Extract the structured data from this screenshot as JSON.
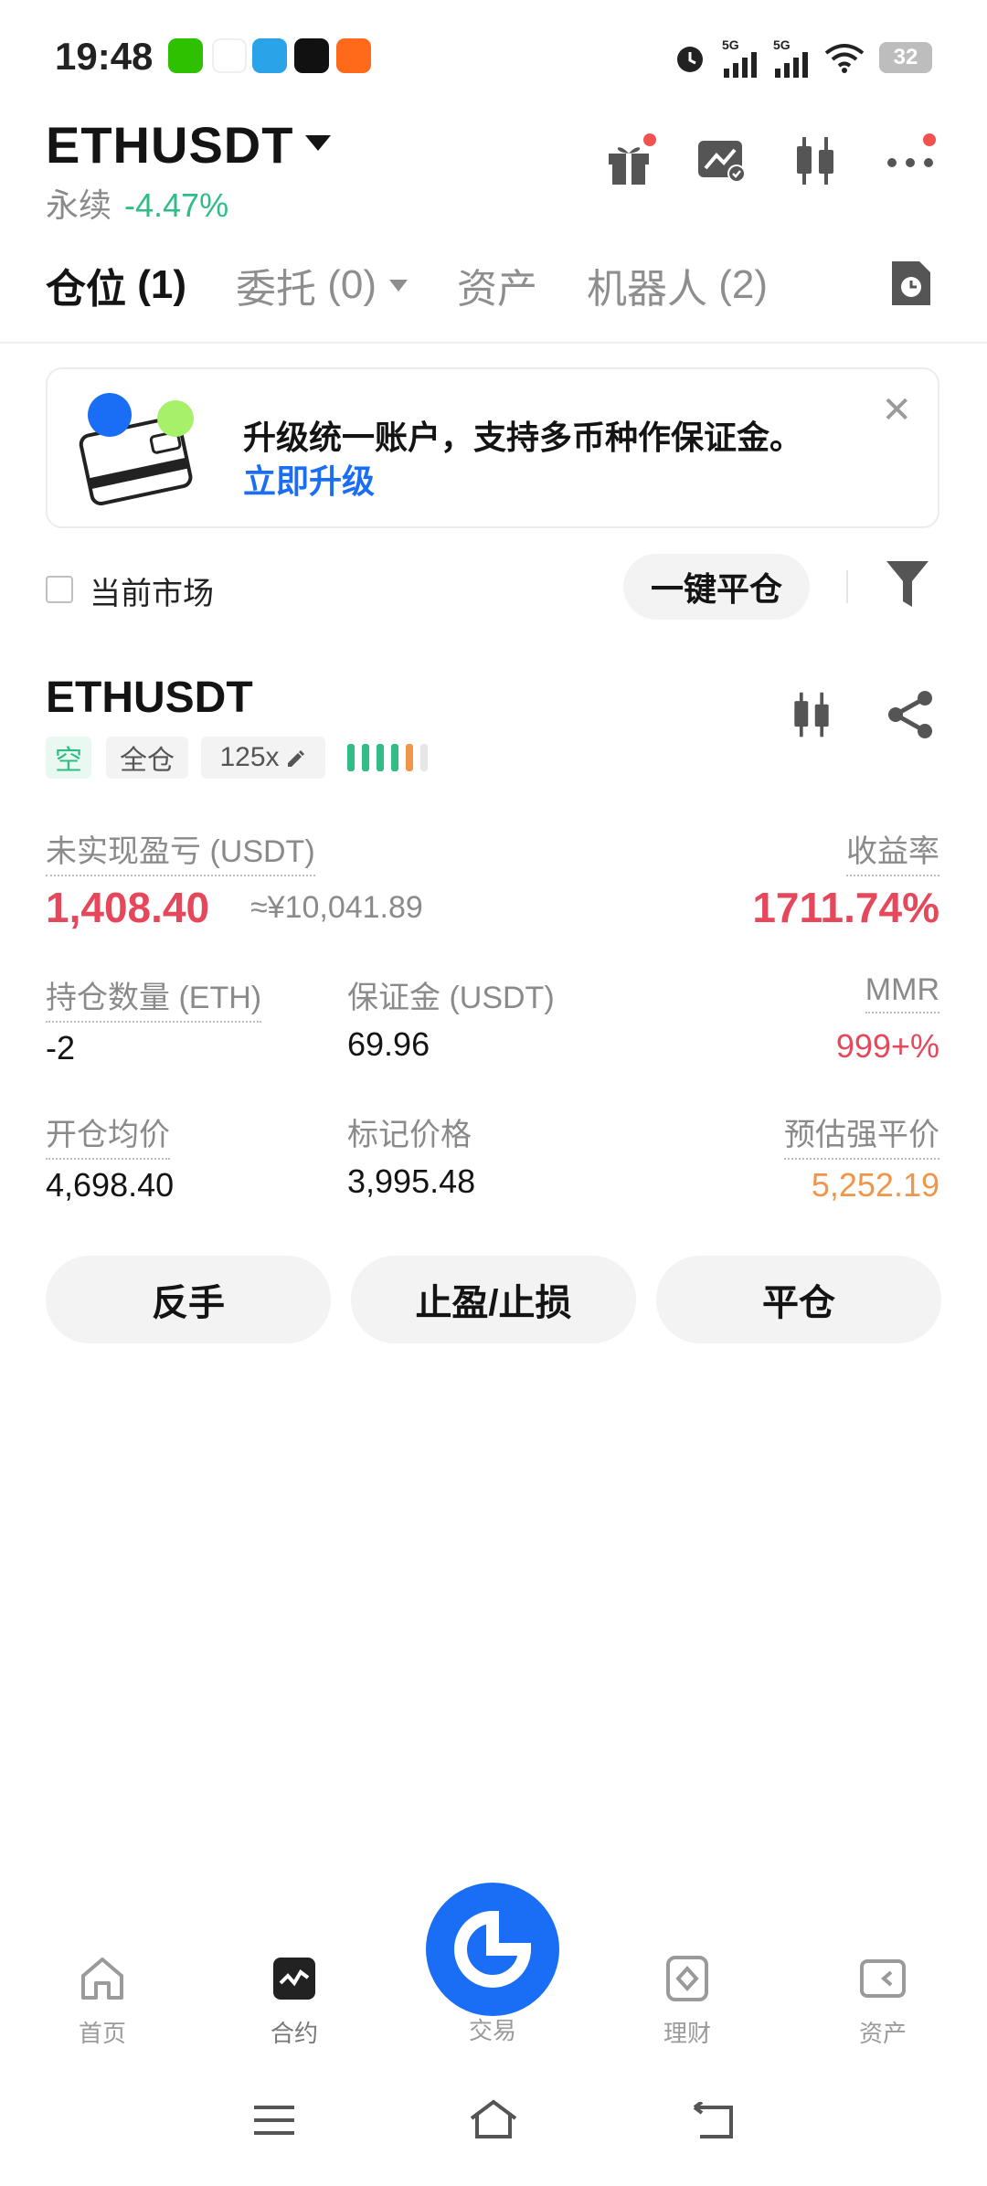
{
  "status_bar": {
    "time": "19:48",
    "net1": "5G",
    "net2": "5G",
    "battery": "32"
  },
  "header": {
    "symbol": "ETHUSDT",
    "contract_type": "永续",
    "change": "-4.47%"
  },
  "tabs": [
    {
      "label": "仓位",
      "count": "(1)"
    },
    {
      "label": "委托",
      "count": "(0)"
    },
    {
      "label": "资产",
      "count": ""
    },
    {
      "label": "机器人",
      "count": "(2)"
    }
  ],
  "banner": {
    "text": "升级统一账户，支持多币种作保证金。",
    "link": "立即升级"
  },
  "filter": {
    "current_market_label": "当前市场",
    "close_all_label": "一键平仓"
  },
  "position": {
    "symbol": "ETHUSDT",
    "side": "空",
    "margin_mode": "全仓",
    "leverage": "125x",
    "unrealized_pnl_label": "未实现盈亏 (USDT)",
    "unrealized_pnl": "1,408.40",
    "unrealized_pnl_cny": "≈¥10,041.89",
    "roe_label": "收益率",
    "roe": "1711.74%",
    "size_label": "持仓数量 (ETH)",
    "size": "-2",
    "margin_label": "保证金 (USDT)",
    "margin": "69.96",
    "mmr_label": "MMR",
    "mmr": "999+%",
    "entry_price_label": "开仓均价",
    "entry_price": "4,698.40",
    "mark_price_label": "标记价格",
    "mark_price": "3,995.48",
    "liq_price_label": "预估强平价",
    "liq_price": "5,252.19"
  },
  "actions": {
    "reverse": "反手",
    "tp_sl": "止盈/止损",
    "close": "平仓"
  },
  "bottom_nav": [
    {
      "label": "首页",
      "icon": "home-icon"
    },
    {
      "label": "合约",
      "icon": "contract-icon"
    },
    {
      "label": "交易",
      "icon": "trade-icon"
    },
    {
      "label": "理财",
      "icon": "earn-icon"
    },
    {
      "label": "资产",
      "icon": "wallet-icon"
    }
  ],
  "colors": {
    "accent": "#1a6ef5",
    "up": "#2fbd85",
    "down": "#e5485b",
    "warn": "#f0964a"
  }
}
